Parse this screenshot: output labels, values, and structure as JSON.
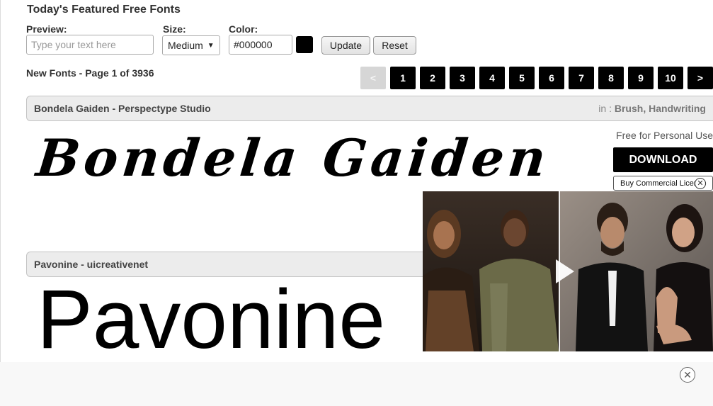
{
  "header": {
    "title": "Today's Featured Free Fonts"
  },
  "controls": {
    "preview_label": "Preview:",
    "preview_placeholder": "Type your text here",
    "size_label": "Size:",
    "size_value": "Medium",
    "color_label": "Color:",
    "color_value": "#000000",
    "swatch_color": "#000000",
    "update_label": "Update",
    "reset_label": "Reset"
  },
  "listing": {
    "page_info": "New Fonts - Page 1 of 3936",
    "pagination": {
      "prev": "<",
      "pages": [
        "1",
        "2",
        "3",
        "4",
        "5",
        "6",
        "7",
        "8",
        "9",
        "10"
      ],
      "next": ">"
    }
  },
  "fonts": [
    {
      "title": "Bondela Gaiden - Perspectype Studio",
      "cat_prefix": "in : ",
      "categories": "Brush, Handwriting",
      "preview": "Bondela Gaiden",
      "licence": "Free for Personal Use",
      "download_label": "DOWNLOAD",
      "commercial_label": "Buy Commercial Licence"
    },
    {
      "title": "Pavonine - uicreativenet",
      "preview": "Pavonine"
    }
  ],
  "ads": {
    "video_ad": "video-advertisement",
    "close_icon": "close-icon",
    "play_icon": "play-icon"
  }
}
